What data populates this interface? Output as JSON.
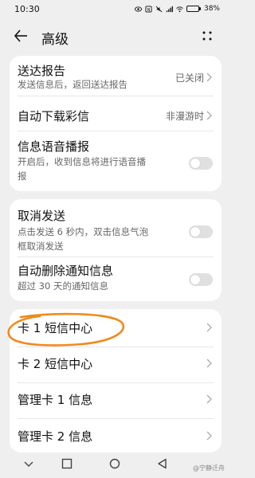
{
  "status_bar": {
    "time": "10:30",
    "battery": "38%"
  },
  "header": {
    "title": "高级"
  },
  "group1": {
    "delivery_report": {
      "label": "送达报告",
      "desc": "发送信息后，返回送达报告",
      "value": "已关闭"
    },
    "auto_download_mms": {
      "label": "自动下载彩信",
      "value": "非漫游时"
    },
    "voice_broadcast": {
      "label": "信息语音播报",
      "desc_line1": "开启后，收到信息将进行语音播",
      "desc_line2": "报",
      "enabled": false
    }
  },
  "group2": {
    "cancel_send": {
      "label": "取消发送",
      "desc_line1": "点击发送 6 秒内，双击信息气泡",
      "desc_line2": "框取消发送",
      "enabled": false
    },
    "auto_delete_notifications": {
      "label": "自动删除通知信息",
      "desc": "超过 30 天的通知信息",
      "enabled": false
    }
  },
  "group3": {
    "items": [
      "卡 1 短信中心",
      "卡 2 短信中心",
      "管理卡 1 信息",
      "管理卡 2 信息"
    ]
  },
  "watermark": "@宁静迁舟",
  "colors": {
    "background": "#efefef",
    "card": "#ffffff",
    "annotation": "#f08a1c",
    "toggle_off": "#e0e0e0"
  },
  "icons": [
    "back-arrow-icon",
    "more-icon",
    "chevron-right-icon",
    "nav-back-icon",
    "nav-home-icon",
    "nav-recents-icon",
    "nav-collapse-icon"
  ]
}
